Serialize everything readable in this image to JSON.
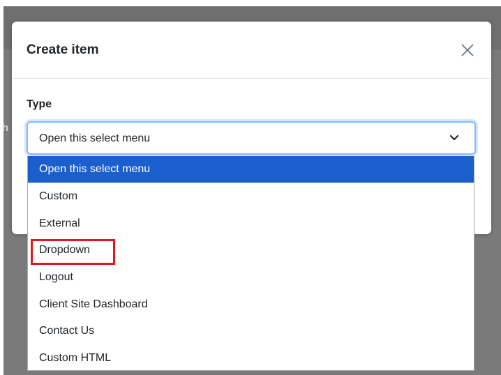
{
  "background": {
    "fragment_text": "h"
  },
  "modal": {
    "title": "Create item",
    "close_glyph": "×",
    "close_icon": "close-icon"
  },
  "form": {
    "type_label": "Type",
    "select": {
      "value": "Open this select menu",
      "chevron_icon": "chevron-down-icon"
    }
  },
  "dropdown": {
    "options": [
      {
        "label": "Open this select menu",
        "selected": true
      },
      {
        "label": "Custom",
        "selected": false
      },
      {
        "label": "External",
        "selected": false
      },
      {
        "label": "Dropdown",
        "selected": false,
        "annotated": true
      },
      {
        "label": "Logout",
        "selected": false
      },
      {
        "label": "Client Site Dashboard",
        "selected": false
      },
      {
        "label": "Contact Us",
        "selected": false
      },
      {
        "label": "Custom HTML",
        "selected": false
      }
    ]
  },
  "colors": {
    "selected_bg": "#1a5fcc",
    "focus_border": "#86b7fe",
    "annotation": "#e5141d",
    "backdrop": "#7a7a7a"
  }
}
